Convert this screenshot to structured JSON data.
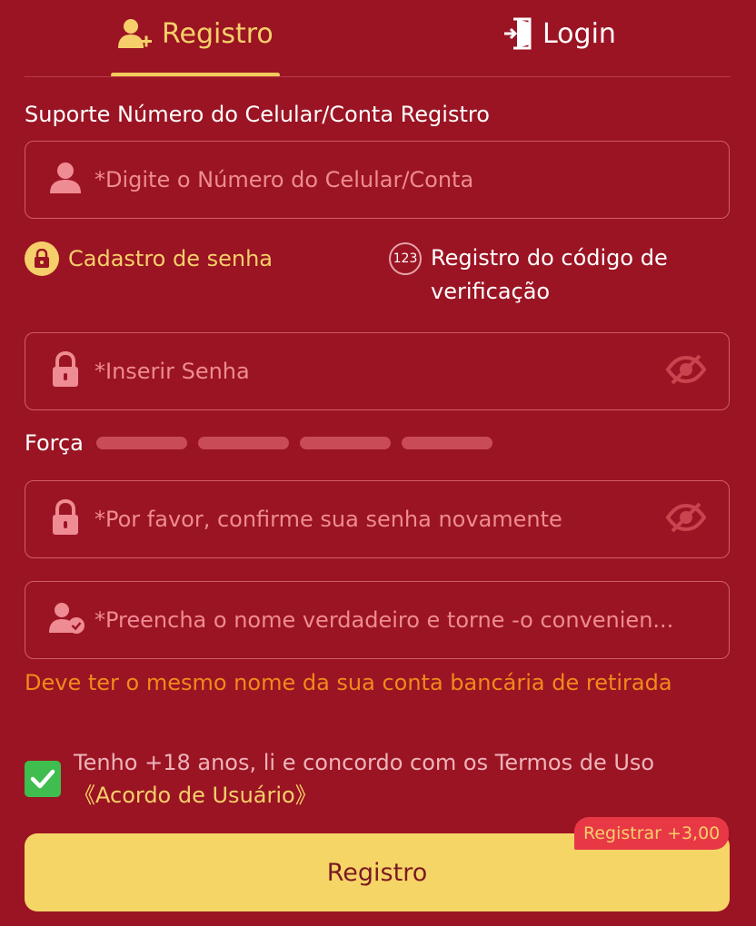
{
  "tabs": {
    "register_label": "Registro",
    "login_label": "Login"
  },
  "form": {
    "support_label": "Suporte Número do Celular/Conta Registro",
    "account_field": {
      "required_mark": "*",
      "placeholder": "Digite o Número do Celular/Conta"
    },
    "methods": {
      "password_label": "Cadastro de senha",
      "code_badge": "123",
      "code_label": "Registro do código de verificação"
    },
    "password_field": {
      "required_mark": "*",
      "placeholder": "Inserir Senha"
    },
    "strength": {
      "label": "Força",
      "bars": 4,
      "level": 0
    },
    "confirm_field": {
      "required_mark": "*",
      "placeholder": "Por favor, confirme sua senha novamente"
    },
    "name_field": {
      "required_mark": "*",
      "placeholder": "Preencha o nome verdadeiro e torne -o convenien..."
    },
    "name_hint": "Deve ter o mesmo nome da sua conta bancária de retirada",
    "agreement": {
      "checked": true,
      "text": "Tenho +18 anos, li e concordo com os Termos de Uso",
      "link": "《Acordo de Usuário》"
    },
    "submit_label": "Registro",
    "bonus_label": "Registrar +3,00"
  },
  "icons": {
    "tab_register": "user-plus-icon",
    "tab_login": "door-enter-icon",
    "account": "user-icon",
    "lock": "lock-icon",
    "eye_off": "eye-off-icon",
    "name": "user-check-icon",
    "check": "check-icon"
  },
  "colors": {
    "background": "#9b1423",
    "accent": "#f6cf6a",
    "field_border": "#cf5d68",
    "placeholder": "#ee8b93",
    "warning": "#f08a1c",
    "checkbox": "#3fbd4e",
    "button": "#f6d567"
  }
}
